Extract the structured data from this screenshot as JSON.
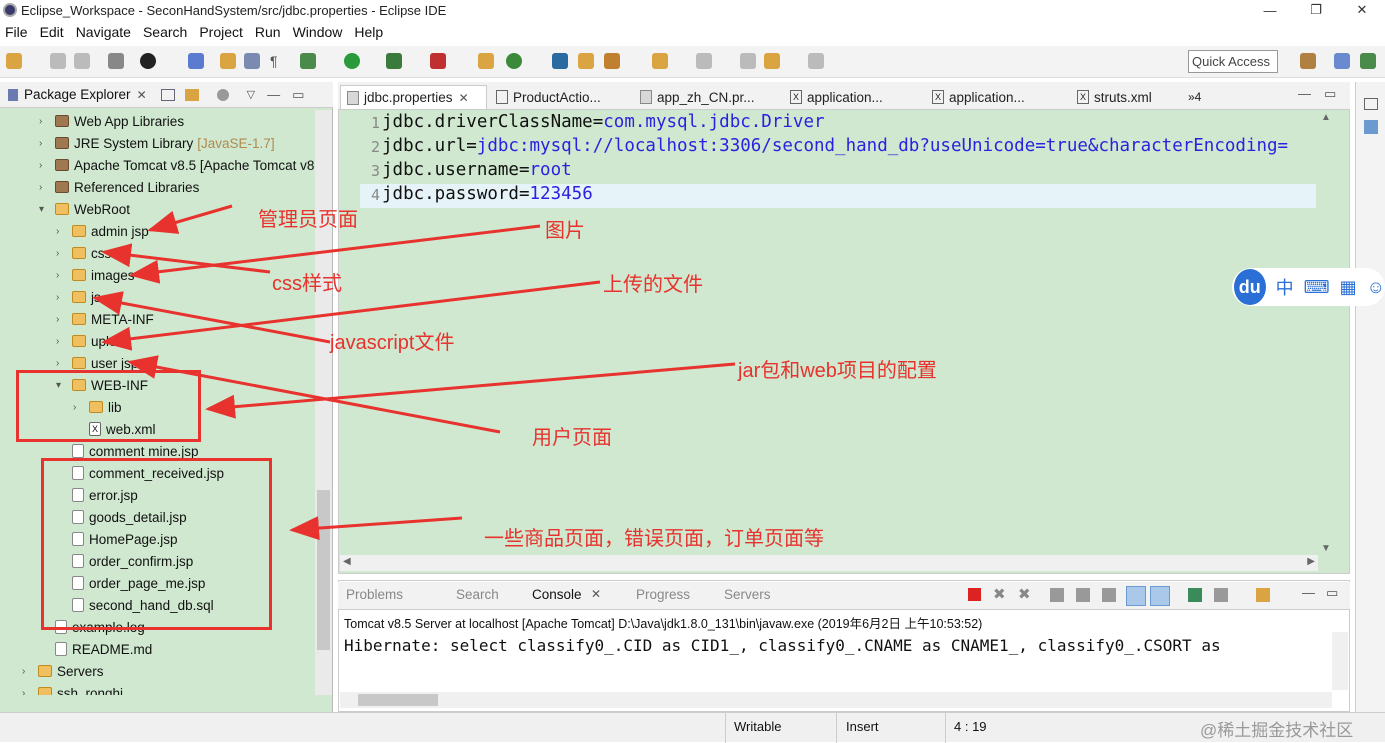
{
  "window": {
    "title": "Eclipse_Workspace - SeconHandSystem/src/jdbc.properties - Eclipse IDE",
    "min": "—",
    "max": "❐",
    "close": "✕"
  },
  "menu": [
    "File",
    "Edit",
    "Navigate",
    "Search",
    "Project",
    "Run",
    "Window",
    "Help"
  ],
  "quick_access": "Quick Access",
  "package_explorer": {
    "title": "Package Explorer"
  },
  "tree": [
    {
      "label": "Web App Libraries",
      "icon": "jar",
      "indent": 1,
      "twisty": ">"
    },
    {
      "label": "JRE System Library",
      "suffix": "[JavaSE-1.7]",
      "icon": "jar",
      "indent": 1,
      "twisty": ">"
    },
    {
      "label": "Apache Tomcat v8.5 [Apache Tomcat v8",
      "icon": "jar",
      "indent": 1,
      "twisty": ">"
    },
    {
      "label": "Referenced Libraries",
      "icon": "jar",
      "indent": 1,
      "twisty": ">"
    },
    {
      "label": "WebRoot",
      "icon": "folder",
      "indent": 1,
      "twisty": "v"
    },
    {
      "label": "admin jsp",
      "icon": "folder",
      "indent": 2,
      "twisty": ">"
    },
    {
      "label": "css",
      "icon": "folder",
      "indent": 2,
      "twisty": ">"
    },
    {
      "label": "images",
      "icon": "folder",
      "indent": 2,
      "twisty": ">"
    },
    {
      "label": "js",
      "icon": "folder",
      "indent": 2,
      "twisty": ">"
    },
    {
      "label": "META-INF",
      "icon": "folder",
      "indent": 2,
      "twisty": ">"
    },
    {
      "label": "upload",
      "icon": "folder",
      "indent": 2,
      "twisty": ">"
    },
    {
      "label": "user jsp",
      "icon": "folder",
      "indent": 2,
      "twisty": ">"
    },
    {
      "label": "WEB-INF",
      "icon": "folder",
      "indent": 2,
      "twisty": "v"
    },
    {
      "label": "lib",
      "icon": "folder",
      "indent": 3,
      "twisty": ">"
    },
    {
      "label": "web.xml",
      "icon": "xml",
      "indent": 3,
      "twisty": ""
    },
    {
      "label": "comment mine.jsp",
      "icon": "file",
      "indent": 2,
      "twisty": ""
    },
    {
      "label": "comment_received.jsp",
      "icon": "file",
      "indent": 2,
      "twisty": ""
    },
    {
      "label": "error.jsp",
      "icon": "file",
      "indent": 2,
      "twisty": ""
    },
    {
      "label": "goods_detail.jsp",
      "icon": "file",
      "indent": 2,
      "twisty": ""
    },
    {
      "label": "HomePage.jsp",
      "icon": "file",
      "indent": 2,
      "twisty": ""
    },
    {
      "label": "order_confirm.jsp",
      "icon": "file",
      "indent": 2,
      "twisty": ""
    },
    {
      "label": "order_page_me.jsp",
      "icon": "file",
      "indent": 2,
      "twisty": ""
    },
    {
      "label": "second_hand_db.sql",
      "icon": "file",
      "indent": 2,
      "twisty": ""
    },
    {
      "label": "example.log",
      "icon": "file",
      "indent": 1,
      "twisty": ""
    },
    {
      "label": "README.md",
      "icon": "file",
      "indent": 1,
      "twisty": ""
    },
    {
      "label": "Servers",
      "icon": "folder",
      "indent": 0,
      "twisty": ">"
    },
    {
      "label": "ssh_ronghi",
      "icon": "folder",
      "indent": 0,
      "twisty": ">"
    }
  ],
  "editor_tabs": [
    "jdbc.properties",
    "ProductActio...",
    "app_zh_CN.pr...",
    "application...",
    "application...",
    "struts.xml",
    "»4"
  ],
  "code": [
    {
      "num": "1",
      "key": "jdbc.driverClassName=",
      "val": "com.mysql.jdbc.Driver"
    },
    {
      "num": "2",
      "key": "jdbc.url=",
      "val": "jdbc:mysql://localhost:3306/second_hand_db?useUnicode=true&characterEncoding="
    },
    {
      "num": "3",
      "key": "jdbc.username=",
      "val": "root"
    },
    {
      "num": "4",
      "key": "jdbc.password=",
      "val": "123456"
    }
  ],
  "bottom_tabs": [
    "Problems",
    "Search",
    "Console",
    "Progress",
    "Servers"
  ],
  "console": {
    "header": "Tomcat v8.5 Server at localhost [Apache Tomcat] D:\\Java\\jdk1.8.0_131\\bin\\javaw.exe (2019年6月2日 上午10:53:52)",
    "line": "Hibernate: select classify0_.CID as CID1_, classify0_.CNAME as CNAME1_, classify0_.CSORT as"
  },
  "status": {
    "writable": "Writable",
    "insert": "Insert",
    "pos": "4 : 19"
  },
  "ime": {
    "logo": "du",
    "items": [
      "中",
      "⌨",
      "▦",
      "☺"
    ]
  },
  "annotations": {
    "admin": "管理员页面",
    "images": "图片",
    "css": "css样式",
    "upload": "上传的文件",
    "js": "javascript文件",
    "webinf": "jar包和web项目的配置",
    "user": "用户页面",
    "pages": "一些商品页面，错误页面，订单页面等"
  },
  "watermark": "@稀土掘金技术社区",
  "colors": {
    "annotation": "#e8322e",
    "editor_bg": "#cfe8cf",
    "code_value": "#2a22e0"
  }
}
